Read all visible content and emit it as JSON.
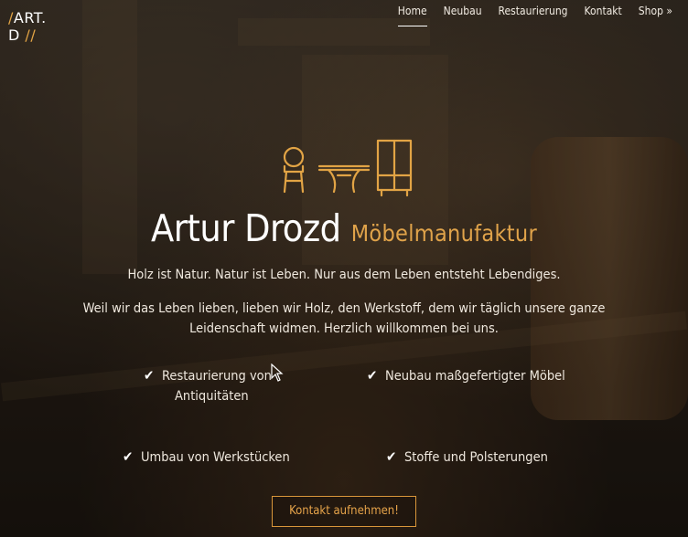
{
  "logo": {
    "slash1": "/",
    "line1": "ART.",
    "line2": "D",
    "slash2": "//"
  },
  "nav": {
    "items": [
      {
        "label": "Home"
      },
      {
        "label": "Neubau"
      },
      {
        "label": "Restaurierung"
      },
      {
        "label": "Kontakt"
      },
      {
        "label": "Shop »"
      }
    ]
  },
  "hero": {
    "icon": "furniture-icon",
    "name": "Artur Drozd",
    "subtitle": "Möbelmanufaktur",
    "lead1": "Holz ist Natur. Natur ist Leben. Nur aus dem Leben entsteht Lebendiges.",
    "lead2": "Weil wir das Leben lieben, lieben wir Holz, den Werkstoff, dem wir täglich unsere ganze Leidenschaft widmen. Herzlich willkommen bei uns."
  },
  "features": {
    "f1_line1": "Restaurierung von",
    "f1_line2": "Antiquitäten",
    "f2": "Neubau maßgefertigter Möbel",
    "f3": "Umbau von Werkstücken",
    "f4": "Stoffe und Polsterungen"
  },
  "cta": {
    "label": "Kontakt aufnehmen!"
  },
  "colors": {
    "accent": "#e0a34a",
    "text": "#ffffff"
  }
}
